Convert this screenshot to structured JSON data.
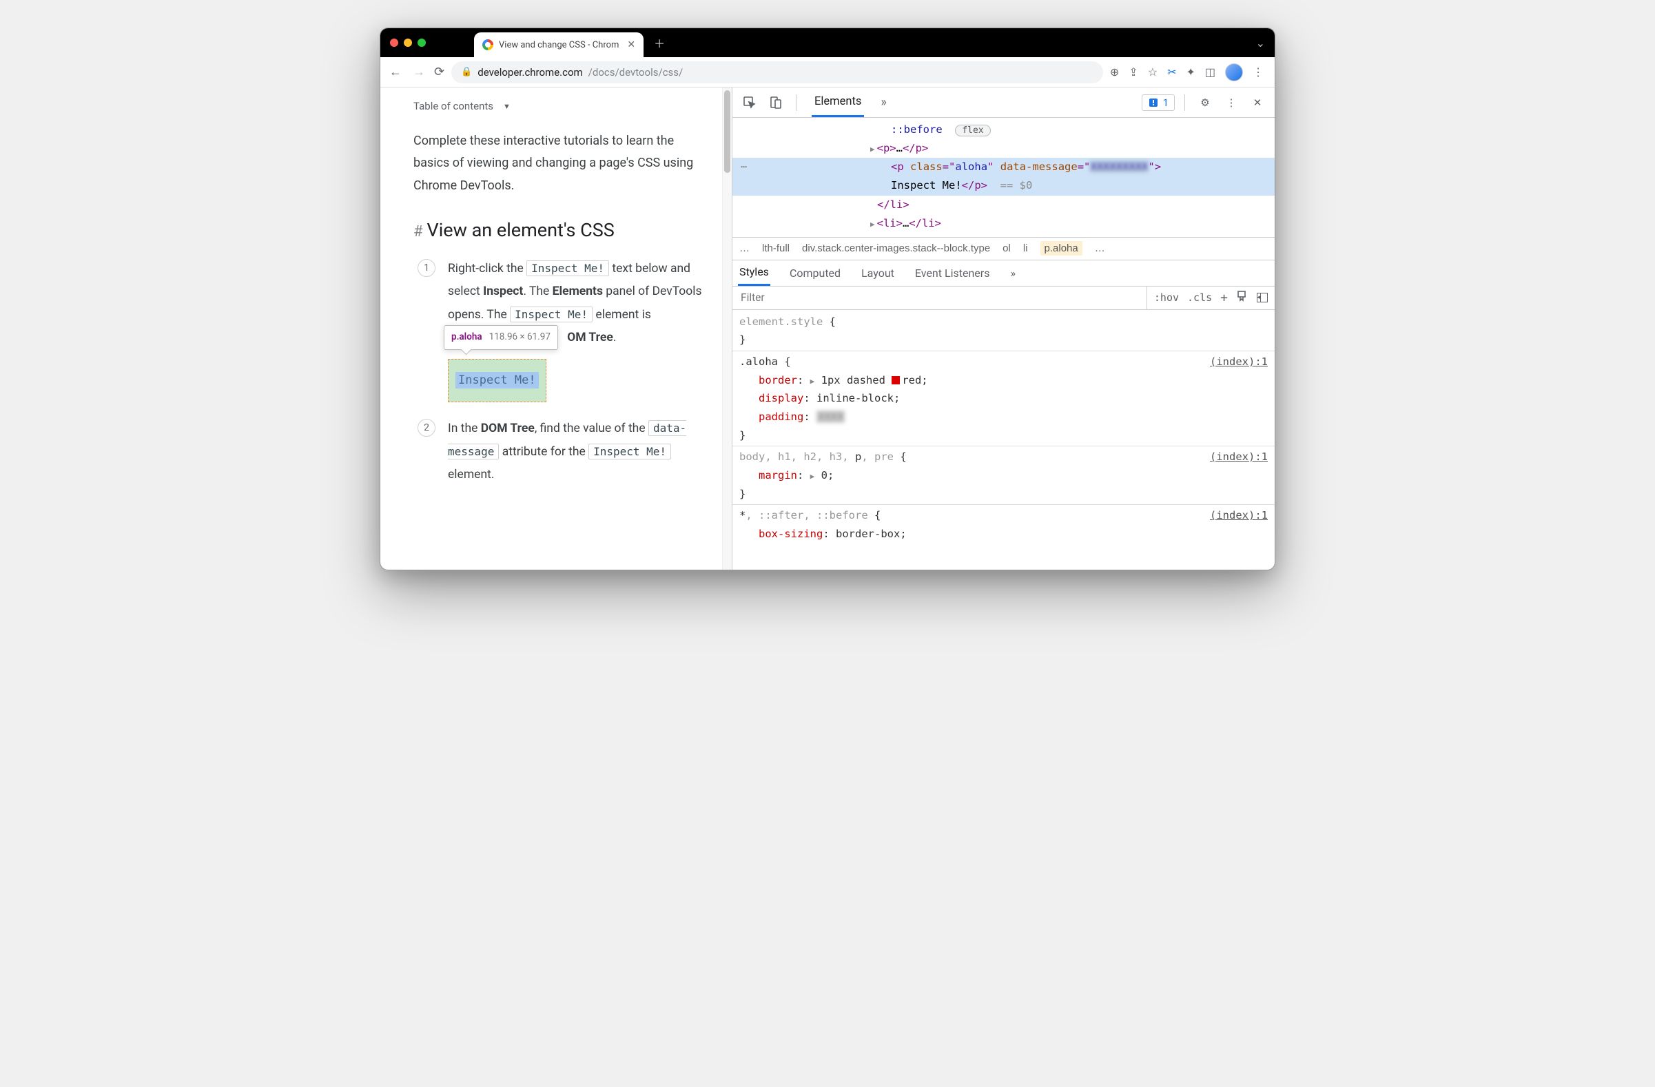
{
  "browser": {
    "tab_title": "View and change CSS - Chrom",
    "url_host": "developer.chrome.com",
    "url_path": "/docs/devtools/css/"
  },
  "page": {
    "toc_label": "Table of contents",
    "intro": "Complete these interactive tutorials to learn the basics of viewing and changing a page's CSS using Chrome DevTools.",
    "heading": "View an element's CSS",
    "step1_a": "Right-click the ",
    "step1_code1": "Inspect Me!",
    "step1_b": " text below and select ",
    "step1_bold1": "Inspect",
    "step1_c": ". The ",
    "step1_bold2": "Elements",
    "step1_d": " panel of DevTools opens. The ",
    "step1_code2": "Inspect Me!",
    "step1_e": " element is",
    "step1_f_suffix": "OM Tree",
    "step1_g": ".",
    "tooltip_sel": "p.aloha",
    "tooltip_dim": "118.96 × 61.97",
    "inspect_target": "Inspect Me!",
    "step2_a": "In the ",
    "step2_bold1": "DOM Tree",
    "step2_b": ", find the value of the ",
    "step2_code1": "data-message",
    "step2_c": " attribute for the ",
    "step2_code2": "Inspect Me!",
    "step2_d": " element."
  },
  "devtools": {
    "header_tab": "Elements",
    "issue_count": "1",
    "dom": {
      "before": "::before",
      "flex_pill": "flex",
      "p_open": "<p>",
      "p_dots": "…",
      "p_close": "</p>",
      "sel_open_tag": "p",
      "sel_attr1_n": "class",
      "sel_attr1_v": "aloha",
      "sel_attr2_n": "data-message",
      "sel_attr2_v_blur": "XXXXXXXXX",
      "sel_text": "Inspect Me!",
      "sel_close": "</p>",
      "eq0": "== $0",
      "li_close": "</li>",
      "li_open": "<li>",
      "li_dots": "…",
      "li_close2": "</li>"
    },
    "breadcrumbs": {
      "dots": "…",
      "c1": "lth-full",
      "c2": "div.stack.center-images.stack--block.type",
      "c3": "ol",
      "c4": "li",
      "c5": "p.aloha",
      "dots2": "…"
    },
    "styles_tabs": {
      "t1": "Styles",
      "t2": "Computed",
      "t3": "Layout",
      "t4": "Event Listeners"
    },
    "filter_placeholder": "Filter",
    "filter_hov": ":hov",
    "filter_cls": ".cls",
    "rules": {
      "r0_sel": "element.style",
      "r1_sel": ".aloha",
      "r1_src": "(index):1",
      "r1_p1n": "border",
      "r1_p1v": "1px dashed ",
      "r1_p1v2": "red",
      "r1_p2n": "display",
      "r1_p2v": "inline-block",
      "r1_p3n": "padding",
      "r1_p3v_blur": "XXXX",
      "r2_sel_a": "body, h1, h2, h3, ",
      "r2_sel_b": "p",
      "r2_sel_c": ", pre",
      "r2_src": "(index):1",
      "r2_p1n": "margin",
      "r2_p1v": "0",
      "r3_sel_a": "*",
      "r3_sel_b": ", ::after, ::before",
      "r3_src": "(index):1",
      "r3_p1n": "box-sizing",
      "r3_p1v": "border-box"
    }
  }
}
